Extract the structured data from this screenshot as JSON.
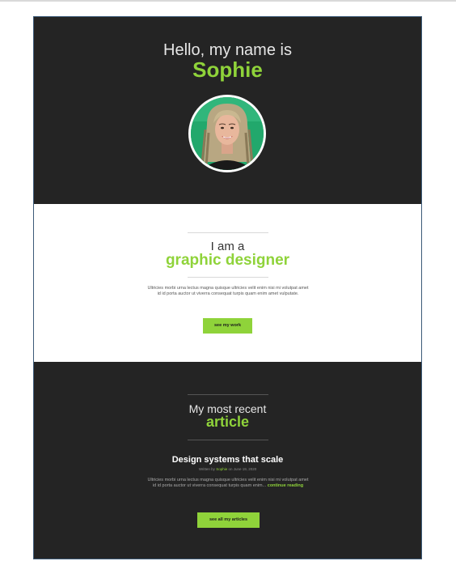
{
  "hero": {
    "greeting": "Hello, my name is",
    "name": "Sophie"
  },
  "about": {
    "intro": "I am a",
    "role": "graphic designer",
    "body": "Ultricies morbi urna lectus magna quisque ultricies velit enim nisi mi volutpat amet id id porta auctor ut viverra consequat turpis quam enim amet vulputate.",
    "cta_label": "see my work"
  },
  "article": {
    "heading_intro": "My most recent",
    "heading_word": "article",
    "post_title": "Design systems that scale",
    "meta_prefix": "Written by",
    "meta_author": "Sophie",
    "meta_date": "on June 19, 2020",
    "body": "Ultricies morbi urna lectus magna quisque ultricies velit enim nisi mi volutpat amet id id porta auctor ut viverra consequat turpis quam enim...",
    "continue_label": "continue reading",
    "cta_label": "see all my articles"
  },
  "colors": {
    "accent": "#8fd33a",
    "dark_bg": "#242424",
    "light_bg": "#ffffff"
  }
}
